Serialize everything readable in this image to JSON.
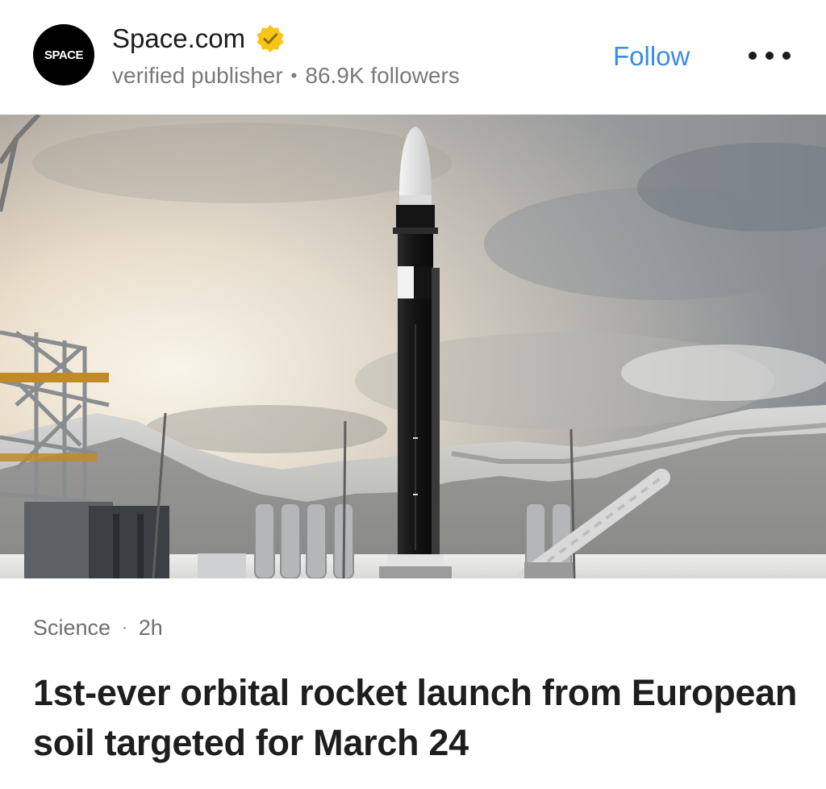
{
  "publisher": {
    "logo_text": "SPACE",
    "name": "Space.com",
    "status": "verified publisher",
    "followers": "86.9K followers",
    "follow_label": "Follow"
  },
  "article": {
    "category": "Science",
    "age": "2h",
    "title": "1st-ever orbital rocket launch from European soil targeted for March 24"
  },
  "icons": {
    "verified": "verified-badge-icon",
    "more": "more-options-icon"
  },
  "colors": {
    "accent": "#3b8be8",
    "badge": "#f5c518",
    "text": "#1e1e1e",
    "muted": "#7a7a7a"
  }
}
